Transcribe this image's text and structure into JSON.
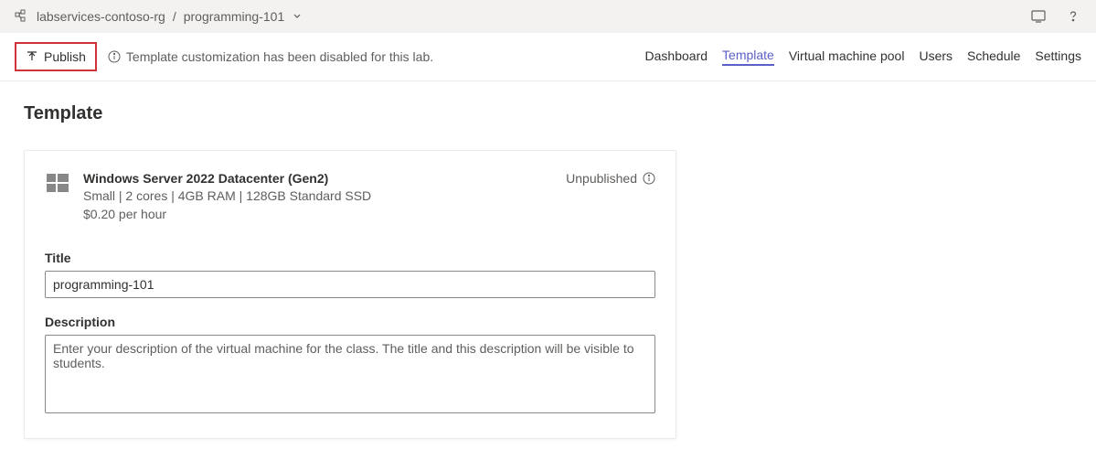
{
  "breadcrumb": {
    "resource_group": "labservices-contoso-rg",
    "lab_name": "programming-101"
  },
  "commandBar": {
    "publish_label": "Publish",
    "info_message": "Template customization has been disabled for this lab."
  },
  "tabs": {
    "dashboard": "Dashboard",
    "template": "Template",
    "vmpool": "Virtual machine pool",
    "users": "Users",
    "schedule": "Schedule",
    "settings": "Settings"
  },
  "page": {
    "title": "Template"
  },
  "template": {
    "name": "Windows Server 2022 Datacenter (Gen2)",
    "spec": "Small | 2 cores | 4GB RAM | 128GB Standard SSD",
    "price": "$0.20 per hour",
    "status": "Unpublished"
  },
  "form": {
    "title_label": "Title",
    "title_value": "programming-101",
    "description_label": "Description",
    "description_value": "",
    "description_placeholder": "Enter your description of the virtual machine for the class. The title and this description will be visible to students."
  }
}
